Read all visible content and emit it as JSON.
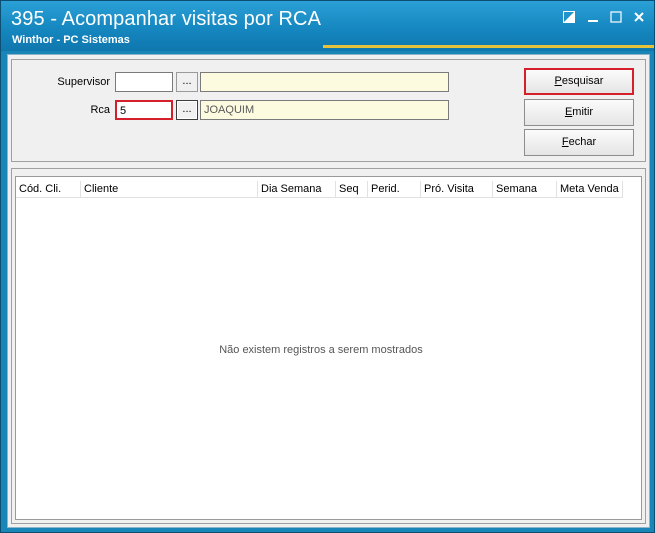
{
  "window": {
    "title": "395 - Acompanhar visitas por RCA",
    "subtitle": "Winthor - PC Sistemas"
  },
  "filters": {
    "supervisor_label": "Supervisor",
    "supervisor_code": "",
    "supervisor_name": "",
    "rca_label": "Rca",
    "rca_code": "5",
    "rca_name": "JOAQUIM",
    "lookup_label": "..."
  },
  "buttons": {
    "pesquisar": "Pesquisar",
    "emitir": "Emitir",
    "fechar": "Fechar"
  },
  "grid": {
    "columns": [
      "Cód. Cli.",
      "Cliente",
      "Dia Semana",
      "Seq",
      "Perid.",
      "Pró. Visita",
      "Semana",
      "Meta Venda"
    ],
    "rows": [],
    "empty_message": "Não existem registros a serem mostrados"
  },
  "colors": {
    "title_bar": "#1687c0",
    "highlight": "#d4202a",
    "lookup_fill": "#fcfbe0"
  },
  "icons": [
    "restore-icon",
    "minimize-icon",
    "maximize-icon",
    "close-icon"
  ]
}
